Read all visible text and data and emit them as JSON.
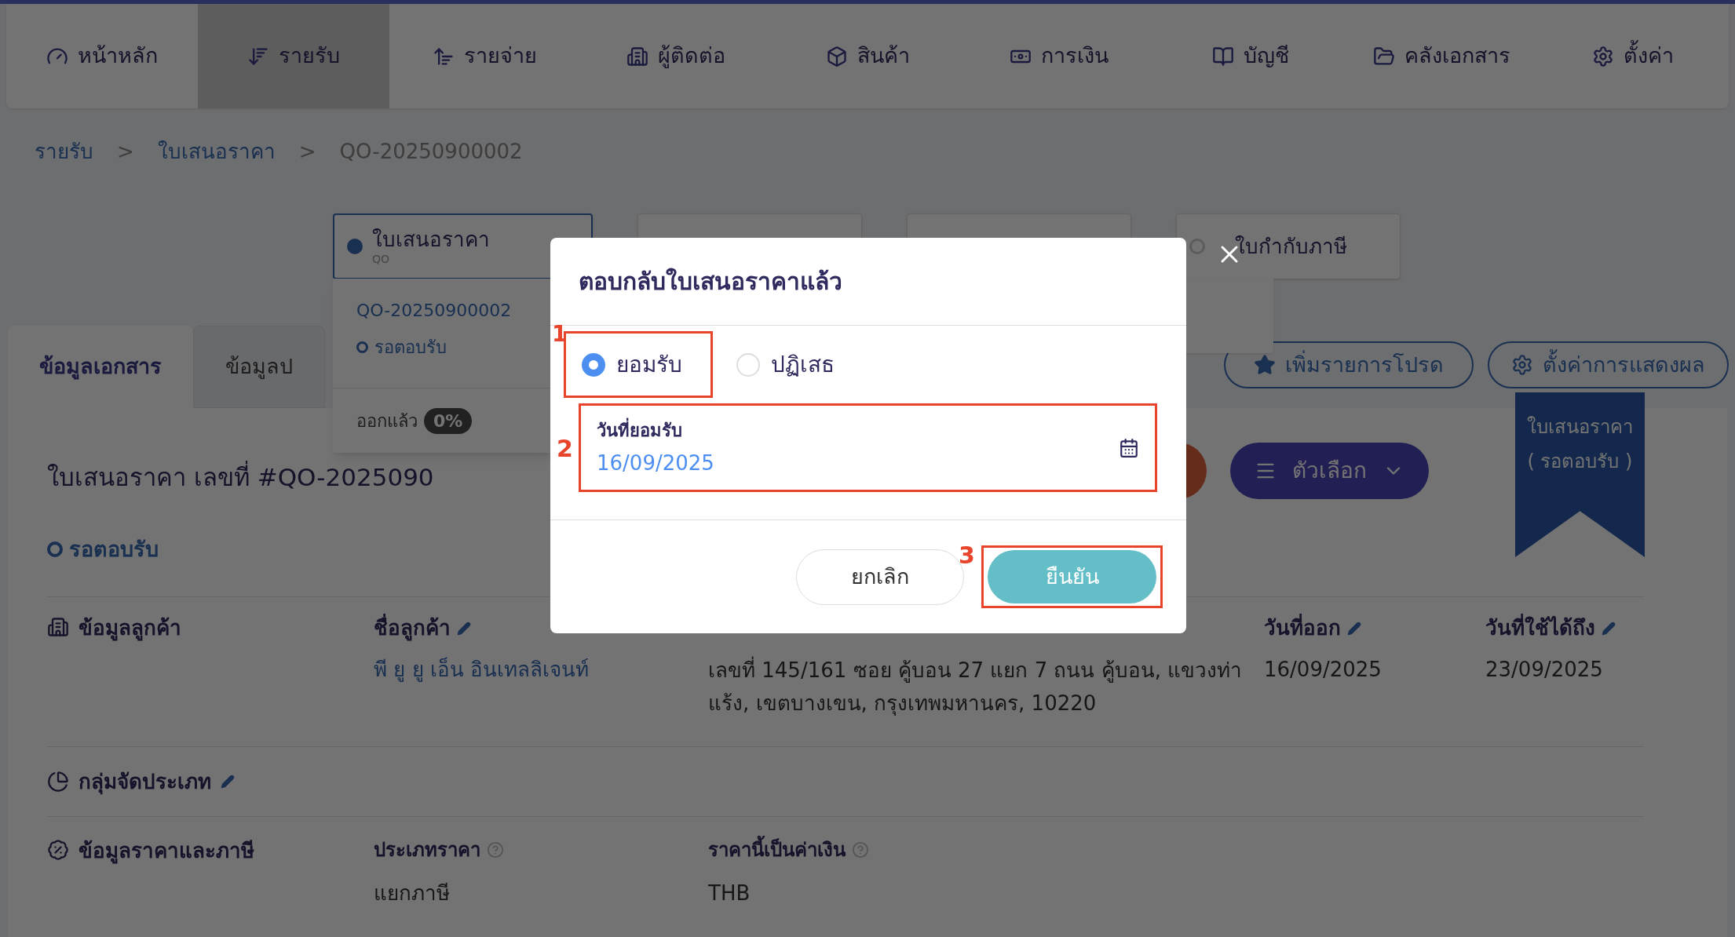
{
  "nav": [
    {
      "label": "หน้าหลัก",
      "selected": false
    },
    {
      "label": "รายรับ",
      "selected": true
    },
    {
      "label": "รายจ่าย",
      "selected": false
    },
    {
      "label": "ผู้ติดต่อ",
      "selected": false
    },
    {
      "label": "สินค้า",
      "selected": false
    },
    {
      "label": "การเงิน",
      "selected": false
    },
    {
      "label": "บัญชี",
      "selected": false
    },
    {
      "label": "คลังเอกสาร",
      "selected": false
    },
    {
      "label": "ตั้งค่า",
      "selected": false
    }
  ],
  "breadcrumb": {
    "links": [
      "รายรับ",
      "ใบเสนอราคา"
    ],
    "separators": [
      ">",
      ">"
    ],
    "current": "QO-20250900002"
  },
  "steps": [
    {
      "label": "ใบเสนอราคา",
      "code": "QO",
      "selected": true
    },
    {
      "selected": false
    },
    {
      "selected": false
    },
    {
      "label": "ใบกำกับภาษี",
      "selected": false
    }
  ],
  "step_dropdown": {
    "number": "QO-20250900002",
    "status": "รอตอบรับ",
    "issued_label": "ออกแล้ว",
    "issued_percent": "0%"
  },
  "tabs": [
    {
      "label": "ข้อมูลเอกสาร",
      "selected": true
    },
    {
      "label": "ข้อมูลป",
      "selected": false
    }
  ],
  "actions": [
    "เพิ่มรายการโปรด",
    "ตั้งค่าการแสดงผล"
  ],
  "document": {
    "title": "ใบเสนอราคา เลขที่ #QO-2025090",
    "status": "รอตอบรับ",
    "options_button": "ตัวเลือก",
    "ribbon": [
      "ใบเสนอราคา",
      "( รอตอบรับ )"
    ]
  },
  "customer": {
    "heading": "ข้อมูลลูกค้า",
    "name_label": "ชื่อลูกค้า",
    "name": "พี ยู ยู เอ็น อินเทลลิเจนท์",
    "address_lines": [
      "เลขที่ 145/161 ซอย คู้บอน 27 แยก 7 ถนน คู้บอน, แขวงท่า",
      "แร้ง, เขตบางเขน, กรุงเทพมหานคร, 10220"
    ],
    "issue_label": "วันที่ออก",
    "issue_date": "16/09/2025",
    "valid_label": "วันที่ใช้ได้ถึง",
    "valid_date": "23/09/2025"
  },
  "category": {
    "heading": "กลุ่มจัดประเภท"
  },
  "pricing": {
    "heading": "ข้อมูลราคาและภาษี",
    "fields": [
      {
        "label": "ประเภทราคา",
        "value": "แยกภาษี"
      },
      {
        "label": "ราคานี้เป็นค่าเงิน",
        "value": "THB"
      }
    ]
  },
  "dialog": {
    "title": "ตอบกลับใบเสนอราคาแล้ว",
    "options": [
      {
        "label": "ยอมรับ",
        "selected": true
      },
      {
        "label": "ปฏิเสธ",
        "selected": false
      }
    ],
    "date_label": "วันที่ยอมรับ",
    "date_value": "16/09/2025",
    "cancel": "ยกเลิก",
    "confirm": "ยืนยัน"
  },
  "annotations": [
    "1",
    "2",
    "3"
  ]
}
